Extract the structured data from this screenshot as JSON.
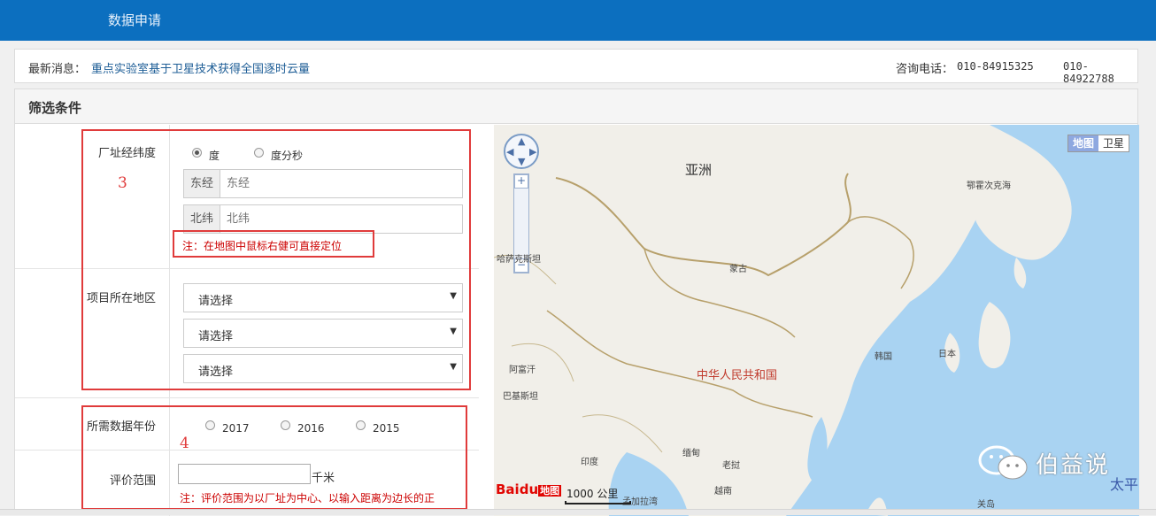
{
  "header": {
    "title": "数据申请"
  },
  "news": {
    "label": "最新消息：",
    "headline": "重点实验室基于卫星技术获得全国逐时云量",
    "phone_label": "咨询电话：",
    "phone1": "010-84915325",
    "phone2": "010-84922788"
  },
  "filter": {
    "title": "筛选条件",
    "coords": {
      "label": "厂址经纬度",
      "units": [
        {
          "label": "度",
          "checked": true
        },
        {
          "label": "度分秒",
          "checked": false
        }
      ],
      "lon_addon": "东经",
      "lon_placeholder": "东经",
      "lat_addon": "北纬",
      "lat_placeholder": "北纬",
      "note": "注：在地图中鼠标右健可直接定位"
    },
    "region": {
      "label": "项目所在地区",
      "selects": [
        "请选择",
        "请选择",
        "请选择"
      ],
      "arrow": "▼"
    },
    "year": {
      "label": "所需数据年份",
      "options": [
        "2017",
        "2016",
        "2015"
      ]
    },
    "range": {
      "label": "评价范围",
      "unit": "千米",
      "note": "注：评价范围为以厂址为中心、以输入距离为边长的正"
    },
    "annotations": {
      "a3": "3",
      "a4": "4"
    }
  },
  "map": {
    "type_buttons": [
      {
        "label": "地图",
        "active": true
      },
      {
        "label": "卫星",
        "active": false
      }
    ],
    "labels": {
      "asia": "亚洲",
      "china": "中华人民共和国",
      "mongolia": "蒙古",
      "korea": "韩国",
      "japan": "日本",
      "okhotsk": "鄂霍次克海",
      "kazakh": "哈萨克斯坦",
      "afghanistan": "阿富汗",
      "pakistan": "巴基斯坦",
      "india": "印度",
      "myanmar": "缅甸",
      "laos": "老挝",
      "vietnam": "越南",
      "philippines": "关岛",
      "bay": "孟加拉湾"
    },
    "scale": "1000 公里",
    "logo": {
      "bai": "Bai",
      "du": "du",
      "map": "地图"
    }
  },
  "watermark": {
    "text": "伯益说",
    "tai": "太平"
  },
  "colors": {
    "header_bg": "#0c6fbf",
    "highlight": "#e03b3b",
    "link": "#1d5d96"
  }
}
